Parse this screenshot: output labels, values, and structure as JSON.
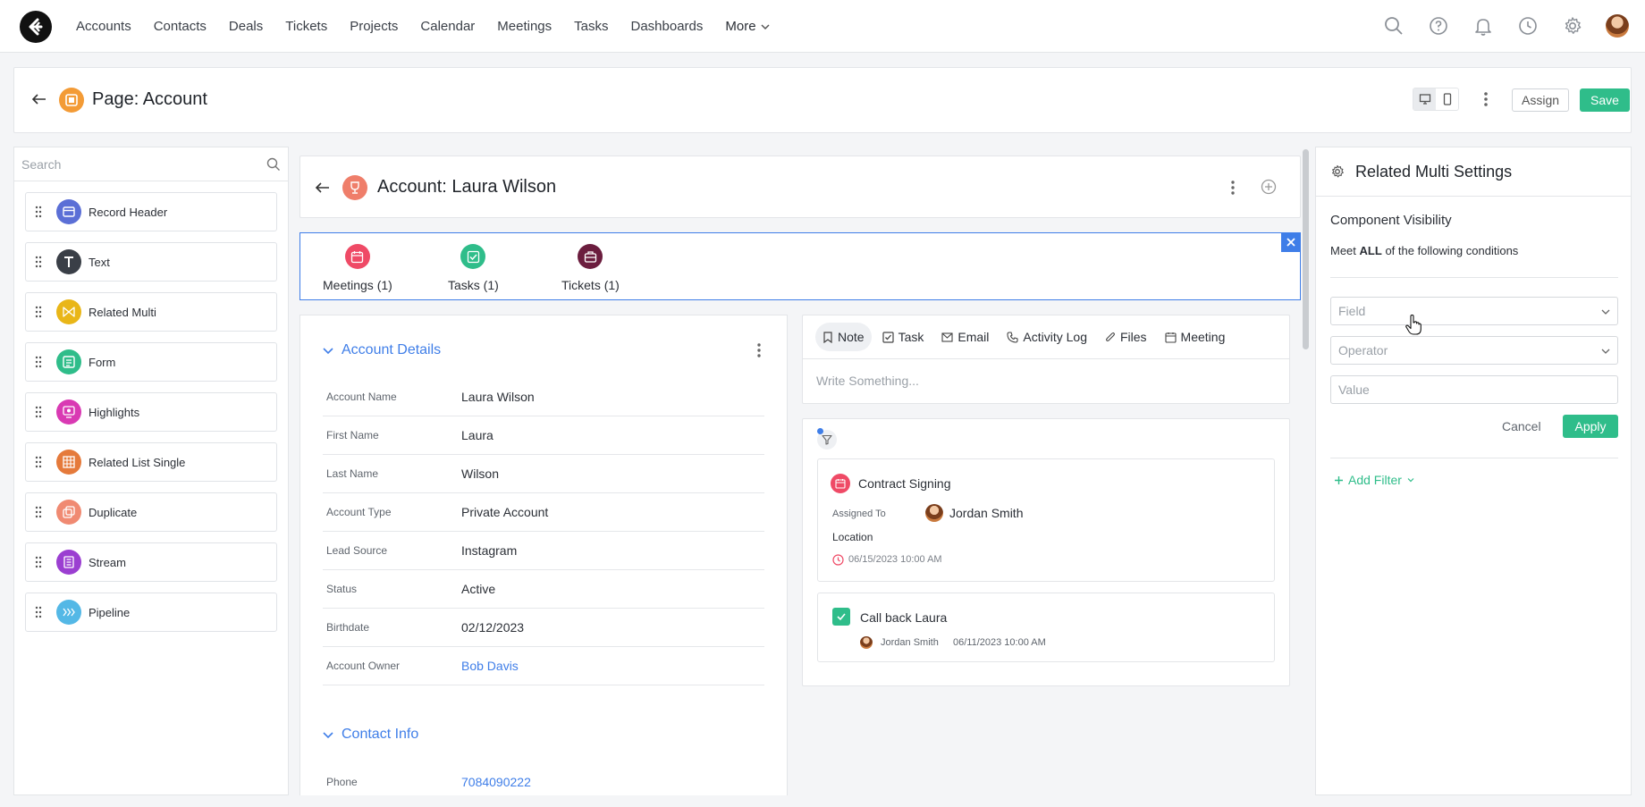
{
  "nav": {
    "items": [
      "Accounts",
      "Contacts",
      "Deals",
      "Tickets",
      "Projects",
      "Calendar",
      "Meetings",
      "Tasks",
      "Dashboards"
    ],
    "more_label": "More"
  },
  "page_bar": {
    "title": "Page: Account",
    "assign_label": "Assign",
    "save_label": "Save"
  },
  "left_panel": {
    "search_placeholder": "Search",
    "components": [
      {
        "label": "Record Header",
        "color": "#5b6fd6"
      },
      {
        "label": "Text",
        "color": "#3a3f47"
      },
      {
        "label": "Related Multi",
        "color": "#e9b618"
      },
      {
        "label": "Form",
        "color": "#2fbd8a"
      },
      {
        "label": "Highlights",
        "color": "#d93ab3"
      },
      {
        "label": "Related List Single",
        "color": "#e57a3b"
      },
      {
        "label": "Duplicate",
        "color": "#f08a72"
      },
      {
        "label": "Stream",
        "color": "#9b3fd1"
      },
      {
        "label": "Pipeline",
        "color": "#54b8e6"
      }
    ]
  },
  "record_header": {
    "title": "Account: Laura Wilson"
  },
  "related_multi": {
    "items": [
      {
        "label": "Meetings (1)",
        "color": "#ef4a66"
      },
      {
        "label": "Tasks (1)",
        "color": "#2fbd8a"
      },
      {
        "label": "Tickets (1)",
        "color": "#6b1d3e"
      }
    ]
  },
  "account_details": {
    "title": "Account Details",
    "fields": [
      {
        "label": "Account Name",
        "value": "Laura Wilson"
      },
      {
        "label": "First Name",
        "value": "Laura"
      },
      {
        "label": "Last Name",
        "value": "Wilson"
      },
      {
        "label": "Account Type",
        "value": "Private Account"
      },
      {
        "label": "Lead Source",
        "value": "Instagram"
      },
      {
        "label": "Status",
        "value": "Active"
      },
      {
        "label": "Birthdate",
        "value": "02/12/2023"
      },
      {
        "label": "Account Owner",
        "value": "Bob Davis"
      }
    ]
  },
  "contact_info": {
    "title": "Contact Info",
    "fields": [
      {
        "label": "Phone",
        "value": "7084090222"
      }
    ]
  },
  "activity": {
    "tabs": [
      "Note",
      "Task",
      "Email",
      "Activity Log",
      "Files",
      "Meeting"
    ],
    "placeholder": "Write Something..."
  },
  "timeline": {
    "meeting": {
      "title": "Contract Signing",
      "assigned_label": "Assigned To",
      "assignee": "Jordan Smith",
      "location_label": "Location",
      "datetime": "06/15/2023 10:00 AM"
    },
    "task": {
      "title": "Call back Laura",
      "assignee": "Jordan Smith",
      "datetime": "06/11/2023 10:00 AM"
    }
  },
  "settings": {
    "title": "Related Multi Settings",
    "section_title": "Component Visibility",
    "cond_prefix": "Meet",
    "cond_bold": "ALL",
    "cond_suffix": "of the following conditions",
    "field_placeholder": "Field",
    "operator_placeholder": "Operator",
    "value_placeholder": "Value",
    "cancel_label": "Cancel",
    "apply_label": "Apply",
    "add_filter_label": "Add Filter"
  }
}
